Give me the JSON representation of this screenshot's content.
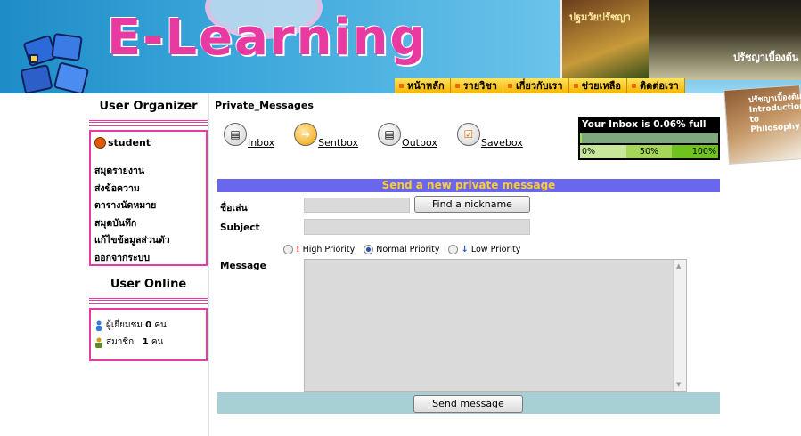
{
  "header": {
    "logo_text": "E-Learning",
    "book1_title": "ปฐมวัยปรัชญา",
    "book2_title": "ปรัชญาเบื้องต้น",
    "book3_title": "ปรัชญาเบื้องต้น Introduction to Philosophy",
    "nav": [
      "หน้าหลัก",
      "รายวิชา",
      "เกี่ยวกับเรา",
      "ช่วยเหลือ",
      "ติดต่อเรา"
    ]
  },
  "sidebar": {
    "organizer_title": "User Organizer",
    "username": "student",
    "menu": [
      "สมุดรายงาน",
      "ส่งข้อความ",
      "ตารางนัดหมาย",
      "สมุดบันทึก",
      "แก้ไขข้อมูลส่วนตัว",
      "ออกจากระบบ"
    ],
    "online_title": "User Online",
    "online": {
      "guests_label": "ผู้เยี่ยมชม",
      "guests_count": "0",
      "guests_unit": "คน",
      "members_label": "สมาชิก",
      "members_count": "1",
      "members_unit": "คน"
    }
  },
  "main": {
    "title": "Private_Messages",
    "folders": [
      "Inbox",
      "Sentbox",
      "Outbox",
      "Savebox"
    ],
    "inbox_meter": {
      "text": "Your Inbox is 0.06% full",
      "fill_fraction": 0.0006,
      "scale": [
        "0%",
        "50%",
        "100%"
      ]
    },
    "form": {
      "header": "Send a new private message",
      "nickname_label": "ชื่อเล่น",
      "find_nickname_button": "Find a nickname",
      "subject_label": "Subject",
      "priority_high": "High Priority",
      "priority_normal": "Normal Priority",
      "priority_low": "Low Priority",
      "priority_selected": "normal",
      "message_label": "Message",
      "send_button": "Send message"
    }
  }
}
